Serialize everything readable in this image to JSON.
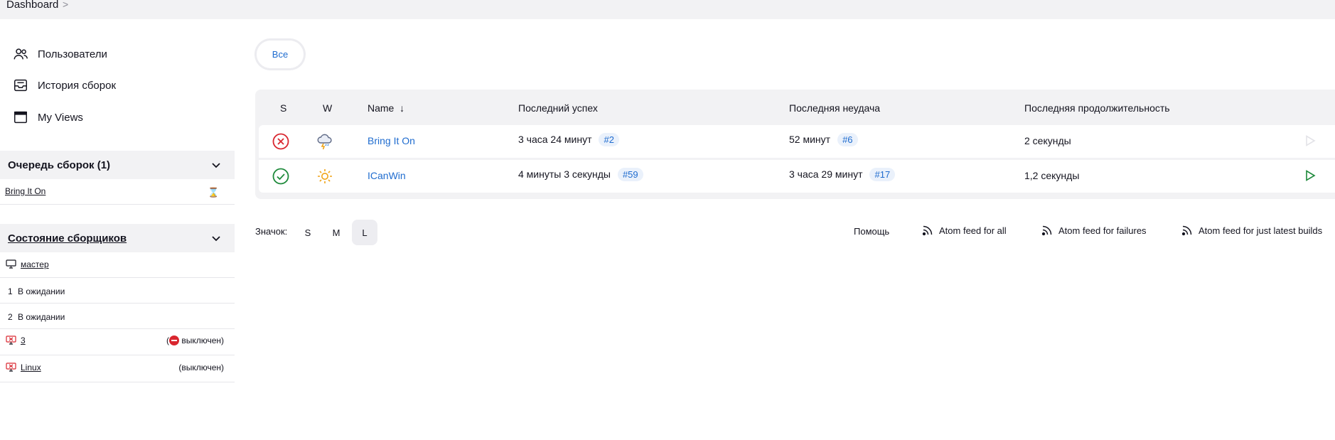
{
  "breadcrumb": {
    "root": "Dashboard",
    "sep": ">"
  },
  "sidebar": {
    "links": [
      {
        "label": "Пользователи",
        "icon": "people-icon"
      },
      {
        "label": "История сборок",
        "icon": "inbox-icon"
      },
      {
        "label": "My Views",
        "icon": "window-icon"
      }
    ]
  },
  "build_queue": {
    "title": "Очередь сборок (1)",
    "items": [
      {
        "label": "Bring It On",
        "icon": "hourglass-icon"
      }
    ]
  },
  "executors": {
    "title": "Состояние сборщиков",
    "nodes": [
      {
        "label": "мастер",
        "icon": "computer-icon"
      },
      {
        "num": "1",
        "status": "В ожидании"
      },
      {
        "num": "2",
        "status": "В ожидании"
      },
      {
        "label": "3",
        "status_pre": "(",
        "status_post": " выключен)",
        "icon": "computer-offline-icon"
      },
      {
        "label": "Linux",
        "status": "(выключен)",
        "icon": "computer-offline-icon"
      }
    ]
  },
  "tabs": {
    "all": "Все"
  },
  "table": {
    "headers": {
      "s": "S",
      "w": "W",
      "name": "Name",
      "sort": "↓",
      "last_success": "Последний успех",
      "last_failure": "Последняя неудача",
      "last_duration": "Последняя продолжительность"
    },
    "rows": [
      {
        "name": "Bring It On",
        "status": "failed",
        "weather": "storm",
        "last_success": "3 часа 24 минут",
        "last_success_build": "#2",
        "last_failure": "52 минут",
        "last_failure_build": "#6",
        "duration": "2 секунды"
      },
      {
        "name": "ICanWin",
        "status": "success",
        "weather": "sunny",
        "last_success": "4 минуты 3 секунды",
        "last_success_build": "#59",
        "last_failure": "3 часа 29 минут",
        "last_failure_build": "#17",
        "duration": "1,2 секунды"
      }
    ]
  },
  "footer": {
    "icon_label": "Значок:",
    "sizes": [
      "S",
      "M",
      "L"
    ],
    "active_size": "L",
    "help": "Помощь",
    "feeds": [
      "Atom feed for all",
      "Atom feed for failures",
      "Atom feed for just latest builds"
    ]
  },
  "colors": {
    "accent": "#1f6ccf",
    "fail": "#d9262f",
    "success": "#1e8a3b",
    "panel": "#f2f2f4"
  }
}
